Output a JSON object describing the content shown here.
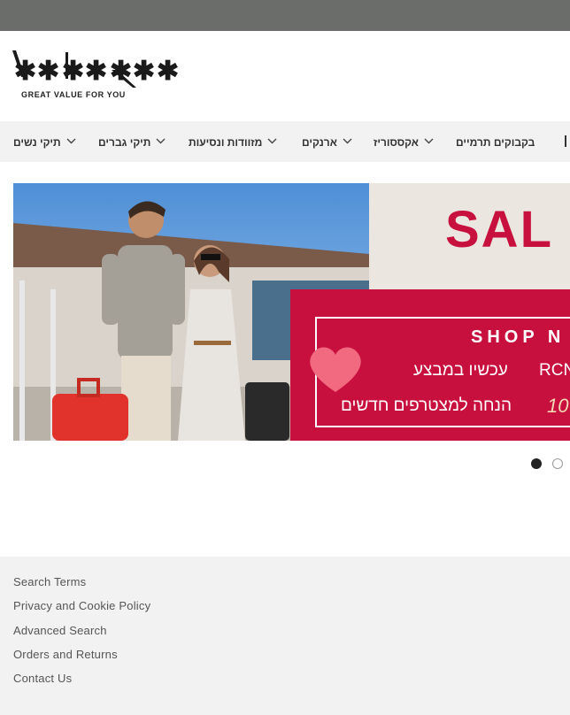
{
  "header": {
    "logo_text": "KALAROK",
    "tagline": "GREAT VALUE FOR YOU"
  },
  "nav": {
    "items": [
      {
        "label": "תיקי נשים"
      },
      {
        "label": "תיקי גברים"
      },
      {
        "label": "מזוודות ונסיעות"
      },
      {
        "label": "ארנקים"
      },
      {
        "label": "אקססוריז"
      },
      {
        "label": "בקבוקים תרמיים"
      }
    ]
  },
  "banner": {
    "sale_text": "SAL",
    "shop_text": "SHOP N",
    "line1": "עכשיו במבצע",
    "code": "RCN",
    "line2": "הנחה למצטרפים חדשים",
    "discount": "10"
  },
  "slider": {
    "slides": 2,
    "active_index": 0
  },
  "footer": {
    "links": [
      "Search Terms",
      "Privacy and Cookie Policy",
      "Advanced Search",
      "Orders and Returns",
      "Contact Us"
    ]
  },
  "colors": {
    "topbar": "#6b6d6a",
    "nav_bg": "#f2f2f2",
    "footer_bg": "#f2f2f2",
    "sale_red": "#c8103e",
    "banner_cream": "#ece6e1"
  }
}
